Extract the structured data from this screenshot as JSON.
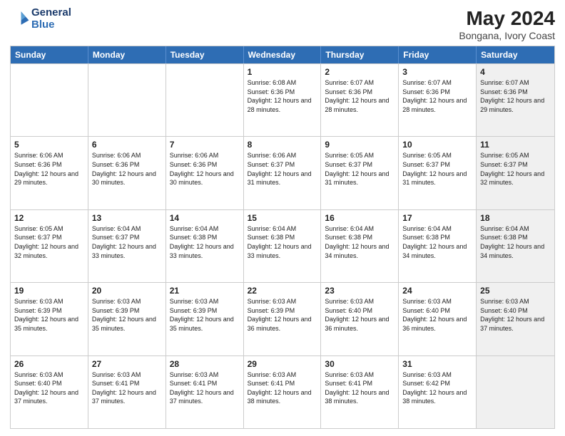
{
  "header": {
    "logo_line1": "General",
    "logo_line2": "Blue",
    "month": "May 2024",
    "location": "Bongana, Ivory Coast"
  },
  "days_of_week": [
    "Sunday",
    "Monday",
    "Tuesday",
    "Wednesday",
    "Thursday",
    "Friday",
    "Saturday"
  ],
  "weeks": [
    [
      {
        "day": "",
        "info": "",
        "shaded": false
      },
      {
        "day": "",
        "info": "",
        "shaded": false
      },
      {
        "day": "",
        "info": "",
        "shaded": false
      },
      {
        "day": "1",
        "info": "Sunrise: 6:08 AM\nSunset: 6:36 PM\nDaylight: 12 hours\nand 28 minutes.",
        "shaded": false
      },
      {
        "day": "2",
        "info": "Sunrise: 6:07 AM\nSunset: 6:36 PM\nDaylight: 12 hours\nand 28 minutes.",
        "shaded": false
      },
      {
        "day": "3",
        "info": "Sunrise: 6:07 AM\nSunset: 6:36 PM\nDaylight: 12 hours\nand 28 minutes.",
        "shaded": false
      },
      {
        "day": "4",
        "info": "Sunrise: 6:07 AM\nSunset: 6:36 PM\nDaylight: 12 hours\nand 29 minutes.",
        "shaded": true
      }
    ],
    [
      {
        "day": "5",
        "info": "Sunrise: 6:06 AM\nSunset: 6:36 PM\nDaylight: 12 hours\nand 29 minutes.",
        "shaded": false
      },
      {
        "day": "6",
        "info": "Sunrise: 6:06 AM\nSunset: 6:36 PM\nDaylight: 12 hours\nand 30 minutes.",
        "shaded": false
      },
      {
        "day": "7",
        "info": "Sunrise: 6:06 AM\nSunset: 6:36 PM\nDaylight: 12 hours\nand 30 minutes.",
        "shaded": false
      },
      {
        "day": "8",
        "info": "Sunrise: 6:06 AM\nSunset: 6:37 PM\nDaylight: 12 hours\nand 31 minutes.",
        "shaded": false
      },
      {
        "day": "9",
        "info": "Sunrise: 6:05 AM\nSunset: 6:37 PM\nDaylight: 12 hours\nand 31 minutes.",
        "shaded": false
      },
      {
        "day": "10",
        "info": "Sunrise: 6:05 AM\nSunset: 6:37 PM\nDaylight: 12 hours\nand 31 minutes.",
        "shaded": false
      },
      {
        "day": "11",
        "info": "Sunrise: 6:05 AM\nSunset: 6:37 PM\nDaylight: 12 hours\nand 32 minutes.",
        "shaded": true
      }
    ],
    [
      {
        "day": "12",
        "info": "Sunrise: 6:05 AM\nSunset: 6:37 PM\nDaylight: 12 hours\nand 32 minutes.",
        "shaded": false
      },
      {
        "day": "13",
        "info": "Sunrise: 6:04 AM\nSunset: 6:37 PM\nDaylight: 12 hours\nand 33 minutes.",
        "shaded": false
      },
      {
        "day": "14",
        "info": "Sunrise: 6:04 AM\nSunset: 6:38 PM\nDaylight: 12 hours\nand 33 minutes.",
        "shaded": false
      },
      {
        "day": "15",
        "info": "Sunrise: 6:04 AM\nSunset: 6:38 PM\nDaylight: 12 hours\nand 33 minutes.",
        "shaded": false
      },
      {
        "day": "16",
        "info": "Sunrise: 6:04 AM\nSunset: 6:38 PM\nDaylight: 12 hours\nand 34 minutes.",
        "shaded": false
      },
      {
        "day": "17",
        "info": "Sunrise: 6:04 AM\nSunset: 6:38 PM\nDaylight: 12 hours\nand 34 minutes.",
        "shaded": false
      },
      {
        "day": "18",
        "info": "Sunrise: 6:04 AM\nSunset: 6:38 PM\nDaylight: 12 hours\nand 34 minutes.",
        "shaded": true
      }
    ],
    [
      {
        "day": "19",
        "info": "Sunrise: 6:03 AM\nSunset: 6:39 PM\nDaylight: 12 hours\nand 35 minutes.",
        "shaded": false
      },
      {
        "day": "20",
        "info": "Sunrise: 6:03 AM\nSunset: 6:39 PM\nDaylight: 12 hours\nand 35 minutes.",
        "shaded": false
      },
      {
        "day": "21",
        "info": "Sunrise: 6:03 AM\nSunset: 6:39 PM\nDaylight: 12 hours\nand 35 minutes.",
        "shaded": false
      },
      {
        "day": "22",
        "info": "Sunrise: 6:03 AM\nSunset: 6:39 PM\nDaylight: 12 hours\nand 36 minutes.",
        "shaded": false
      },
      {
        "day": "23",
        "info": "Sunrise: 6:03 AM\nSunset: 6:40 PM\nDaylight: 12 hours\nand 36 minutes.",
        "shaded": false
      },
      {
        "day": "24",
        "info": "Sunrise: 6:03 AM\nSunset: 6:40 PM\nDaylight: 12 hours\nand 36 minutes.",
        "shaded": false
      },
      {
        "day": "25",
        "info": "Sunrise: 6:03 AM\nSunset: 6:40 PM\nDaylight: 12 hours\nand 37 minutes.",
        "shaded": true
      }
    ],
    [
      {
        "day": "26",
        "info": "Sunrise: 6:03 AM\nSunset: 6:40 PM\nDaylight: 12 hours\nand 37 minutes.",
        "shaded": false
      },
      {
        "day": "27",
        "info": "Sunrise: 6:03 AM\nSunset: 6:41 PM\nDaylight: 12 hours\nand 37 minutes.",
        "shaded": false
      },
      {
        "day": "28",
        "info": "Sunrise: 6:03 AM\nSunset: 6:41 PM\nDaylight: 12 hours\nand 37 minutes.",
        "shaded": false
      },
      {
        "day": "29",
        "info": "Sunrise: 6:03 AM\nSunset: 6:41 PM\nDaylight: 12 hours\nand 38 minutes.",
        "shaded": false
      },
      {
        "day": "30",
        "info": "Sunrise: 6:03 AM\nSunset: 6:41 PM\nDaylight: 12 hours\nand 38 minutes.",
        "shaded": false
      },
      {
        "day": "31",
        "info": "Sunrise: 6:03 AM\nSunset: 6:42 PM\nDaylight: 12 hours\nand 38 minutes.",
        "shaded": false
      },
      {
        "day": "",
        "info": "",
        "shaded": true
      }
    ]
  ]
}
